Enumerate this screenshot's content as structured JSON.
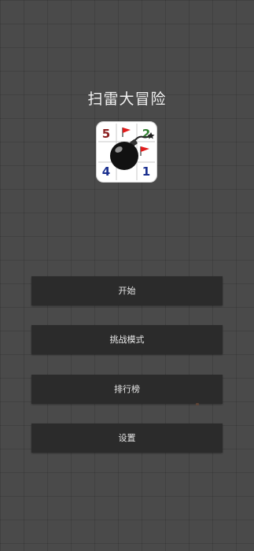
{
  "app": {
    "title": "扫雷大冒险"
  },
  "logo": {
    "icon": "minesweeper-bomb-icon",
    "cell_numbers": [
      "5",
      "2",
      "4",
      "1"
    ],
    "colors": {
      "five": "#8b1f1f",
      "two": "#2f7d2f",
      "four": "#1a2f8f",
      "one": "#1a2f8f",
      "flag": "#e01b1b",
      "bomb": "#111111"
    }
  },
  "menu": {
    "start_label": "开始",
    "challenge_label": "挑战模式",
    "leaderboard_label": "排行榜",
    "settings_label": "设置"
  },
  "colors": {
    "background": "#4a4a4a",
    "button": "#2b2b2b",
    "button_text": "#e8e8e8"
  }
}
